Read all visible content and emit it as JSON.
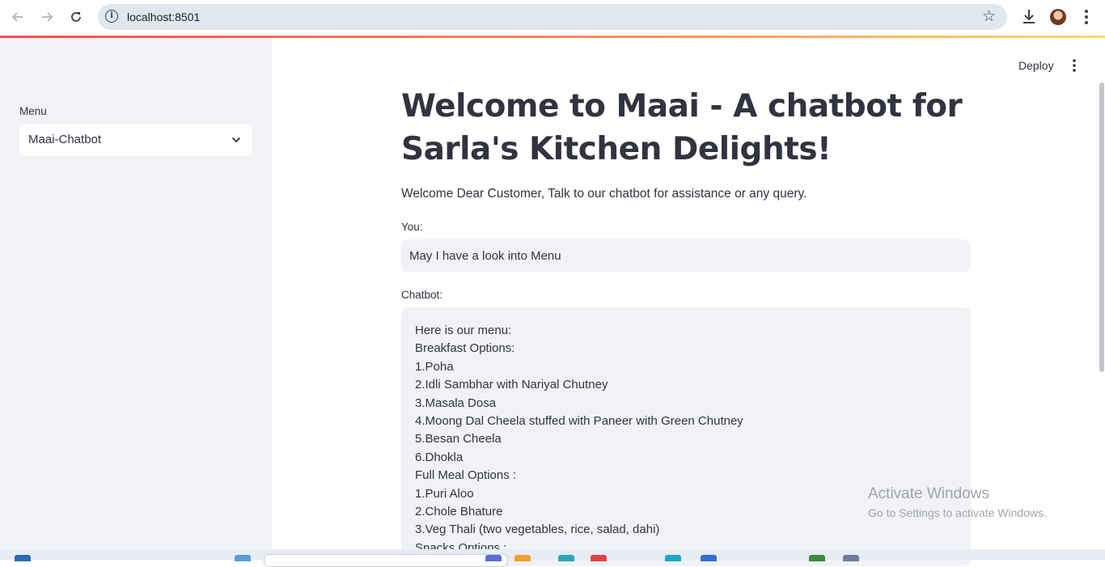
{
  "browser": {
    "url": "localhost:8501",
    "back_icon": "arrow-left-icon",
    "forward_icon": "arrow-right-icon",
    "reload_icon": "reload-icon",
    "info_icon": "info-icon",
    "bookmark_icon": "star-icon",
    "download_icon": "download-icon",
    "profile_icon": "avatar-icon",
    "menu_icon": "vertical-dots-icon"
  },
  "sidebar": {
    "menu_label": "Menu",
    "selected_option": "Maai-Chatbot"
  },
  "header": {
    "deploy_label": "Deploy"
  },
  "main": {
    "title": "Welcome to Maai - A chatbot for Sarla's Kitchen Delights!",
    "subtitle": "Welcome Dear Customer, Talk to our chatbot for assistance or any query.",
    "you_label": "You:",
    "you_value": "May I have a look into Menu",
    "chatbot_label": "Chatbot:",
    "chatbot_lines": [
      "Here is our menu:",
      "Breakfast Options:",
      "1.Poha",
      "2.Idli Sambhar with Nariyal Chutney",
      "3.Masala Dosa",
      "4.Moong Dal Cheela stuffed with Paneer with Green Chutney",
      "5.Besan Cheela",
      "6.Dhokla",
      "Full Meal Options :",
      "1.Puri Aloo",
      "2.Chole Bhature",
      "3.Veg Thali (two vegetables, rice, salad, dahi)",
      "Snacks Options :"
    ]
  },
  "watermark": {
    "line1": "Activate Windows",
    "line2": "Go to Settings to activate Windows."
  },
  "colors": {
    "accent": "#ff4b4b",
    "sidebar_bg": "#f0f2f6",
    "text": "#31333f"
  }
}
